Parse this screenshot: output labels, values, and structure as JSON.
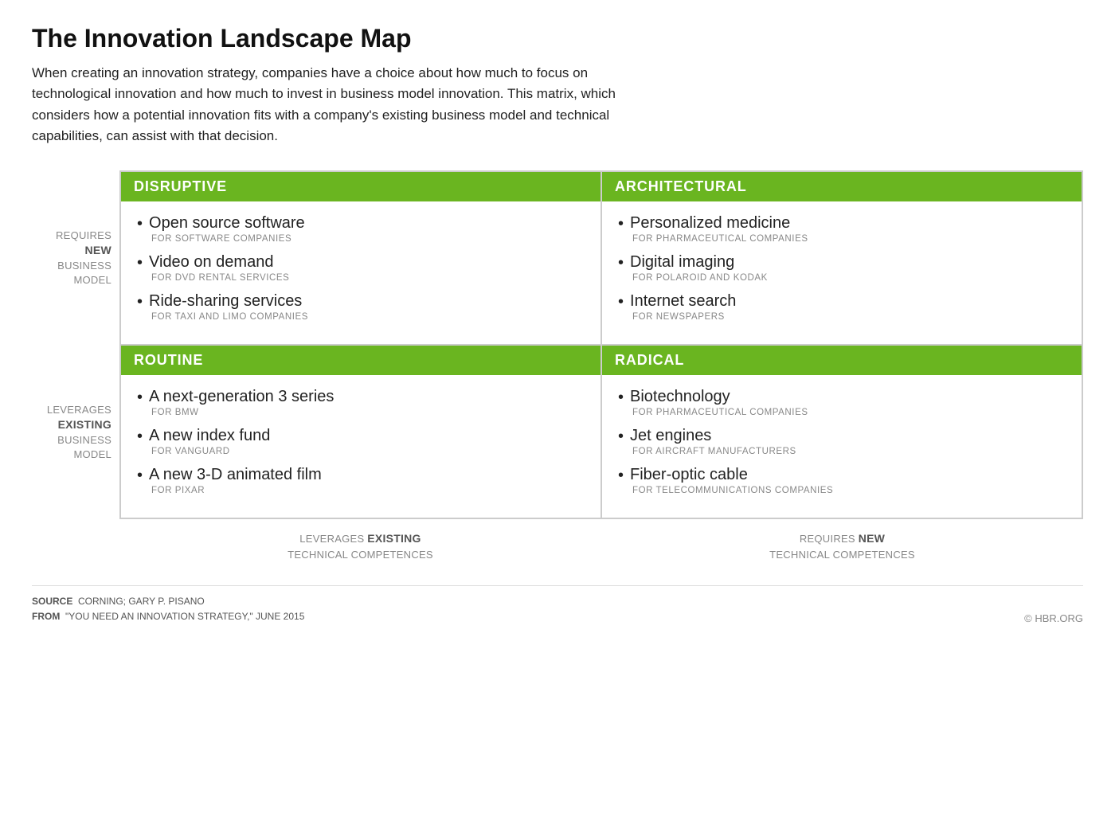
{
  "title": "The Innovation Landscape Map",
  "description": "When creating an innovation strategy, companies have a choice about how much to focus on technological innovation and how much to invest in business model innovation. This matrix, which considers how a potential innovation fits with a company's existing business model and technical capabilities, can assist with that decision.",
  "y_labels": {
    "top": {
      "line1": "REQUIRES",
      "bold": "NEW",
      "line2": "BUSINESS",
      "line3": "MODEL"
    },
    "bottom": {
      "line1": "LEVERAGES",
      "bold": "EXISTING",
      "line2": "BUSINESS",
      "line3": "MODEL"
    }
  },
  "x_labels": {
    "left": {
      "line1": "LEVERAGES",
      "bold": "EXISTING",
      "line2": "TECHNICAL COMPETENCES"
    },
    "right": {
      "line1": "REQUIRES",
      "bold": "NEW",
      "line2": "TECHNICAL COMPETENCES"
    }
  },
  "quadrants": {
    "disruptive": {
      "header": "DISRUPTIVE",
      "items": [
        {
          "main": "Open source software",
          "sub": "FOR SOFTWARE COMPANIES"
        },
        {
          "main": "Video on demand",
          "sub": "FOR DVD RENTAL SERVICES"
        },
        {
          "main": "Ride-sharing services",
          "sub": "FOR TAXI AND LIMO COMPANIES"
        }
      ]
    },
    "architectural": {
      "header": "ARCHITECTURAL",
      "items": [
        {
          "main": "Personalized medicine",
          "sub": "FOR PHARMACEUTICAL COMPANIES"
        },
        {
          "main": "Digital imaging",
          "sub": "FOR POLAROID AND KODAK"
        },
        {
          "main": "Internet search",
          "sub": "FOR NEWSPAPERS"
        }
      ]
    },
    "routine": {
      "header": "ROUTINE",
      "items": [
        {
          "main": "A next-generation 3 series",
          "sub": "FOR BMW"
        },
        {
          "main": "A new index fund",
          "sub": "FOR VANGUARD"
        },
        {
          "main": "A new 3-D animated film",
          "sub": "FOR PIXAR"
        }
      ]
    },
    "radical": {
      "header": "RADICAL",
      "items": [
        {
          "main": "Biotechnology",
          "sub": "FOR PHARMACEUTICAL COMPANIES"
        },
        {
          "main": "Jet engines",
          "sub": "FOR AIRCRAFT MANUFACTURERS"
        },
        {
          "main": "Fiber-optic cable",
          "sub": "FOR TELECOMMUNICATIONS COMPANIES"
        }
      ]
    }
  },
  "footer": {
    "source_label": "SOURCE",
    "source_text": "CORNING; GARY P. PISANO",
    "from_label": "FROM",
    "from_text": "\"YOU NEED AN INNOVATION STRATEGY,\" JUNE 2015",
    "copyright": "© HBR.ORG"
  }
}
